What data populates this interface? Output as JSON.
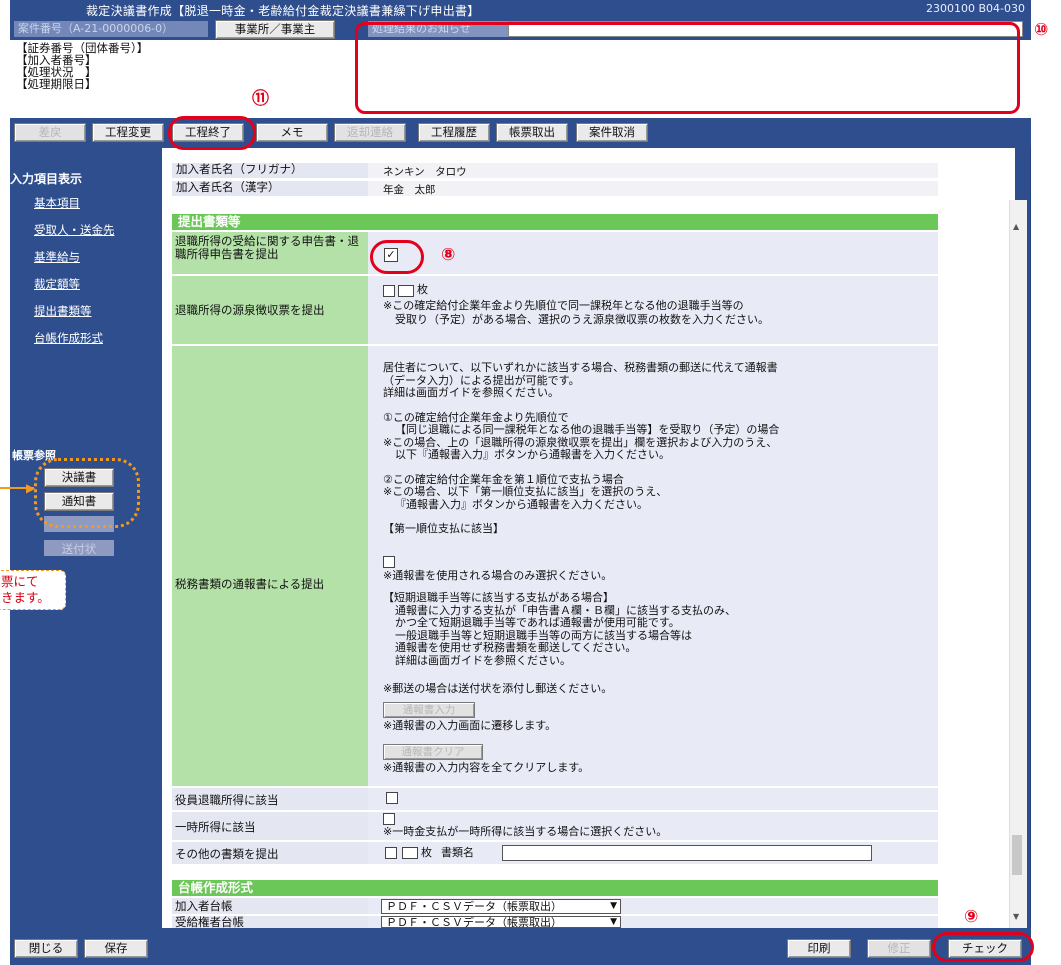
{
  "window": {
    "title": "裁定決議書作成【脱退一時金・老齢給付金裁定決議書兼繰下げ申出書】",
    "screen_code": "2300100 B04-030"
  },
  "case_bar": {
    "case_no": "案件番号（A-21-0000006-0）",
    "office_button": "事業所／事業主",
    "notice_label": "処理結果のお知らせ"
  },
  "info_lines": [
    "【証券番号（団体番号）】",
    "【加入者番号】",
    "【処理状況　】",
    "【処理期限日】"
  ],
  "toolbar": {
    "buttons": [
      "差戻",
      "工程変更",
      "工程終了",
      "メモ",
      "返却連絡",
      "工程履歴",
      "帳票取出",
      "案件取消"
    ]
  },
  "sidebar": {
    "heading": "入力項目表示",
    "items": [
      "基本項目",
      "受取人・送金先",
      "基準給与",
      "裁定額等",
      "提出書類等",
      "台帳作成形式"
    ],
    "report_heading": "帳票参照",
    "report_buttons": [
      "決議書",
      "通知書",
      "",
      "送付状"
    ]
  },
  "member": {
    "kana_label": "加入者氏名（フリガナ）",
    "kana_value": "ネンキン　タロウ",
    "kanji_label": "加入者氏名（漢字）",
    "kanji_value": "年金　太郎"
  },
  "submission": {
    "section_title": "提出書類等",
    "row1_label": "退職所得の受給に関する申告書・退職所得申告書を提出",
    "row1_checked": true,
    "row2_label": "退職所得の源泉徴収票を提出",
    "row2_unit": "枚",
    "row2_note1": "※この確定給付企業年金より先順位で同一課税年となる他の退職手当等の",
    "row2_note2": "受取り（予定）がある場合、選択のうえ源泉徴収票の枚数を入力ください。",
    "row3_label": "税務書類の通報書による提出",
    "row3_lines": [
      "居住者について、以下いずれかに該当する場合、税務書類の郵送に代えて通報書",
      "（データ入力）による提出が可能です。",
      "詳細は画面ガイドを参照ください。",
      "",
      "①この確定給付企業年金より先順位で",
      "【同じ退職による同一課税年となる他の退職手当等】を受取り（予定）の場合",
      "※この場合、上の「退職所得の源泉徴収票を提出」欄を選択および入力のうえ、",
      "以下『通報書入力』ボタンから通報書を入力ください。",
      "",
      "②この確定給付企業年金を第１順位で支払う場合",
      "※この場合、以下「第一順位支払に該当」を選択のうえ、",
      "『通報書入力』ボタンから通報書を入力ください。",
      "",
      "【第一順位支払に該当】"
    ],
    "row3_note_select": "※通報書を使用される場合のみ選択ください。",
    "row3_lines2": [
      "【短期退職手当等に該当する支払がある場合】",
      "通報書に入力する支払が「申告書Ａ欄・Ｂ欄」に該当する支払のみ、",
      "かつ全て短期退職手当等であれば通報書が使用可能です。",
      "一般退職手当等と短期退職手当等の両方に該当する場合等は",
      "通報書を使用せず税務書類を郵送してください。",
      "詳細は画面ガイドを参照ください。"
    ],
    "row3_mail_note": "※郵送の場合は送付状を添付し郵送ください。",
    "input_button": "通報書入力",
    "input_note": "※通報書の入力画面に遷移します。",
    "clear_button": "通報書クリア",
    "clear_note": "※通報書の入力内容を全てクリアします。",
    "row4_label": "役員退職所得に該当",
    "row5_label": "一時所得に該当",
    "row5_note": "※一時金支払が一時所得に該当する場合に選択ください。",
    "row6_label": "その他の書類を提出",
    "row6_unit": "枚",
    "row6_docname": "書類名"
  },
  "ledger": {
    "section_title": "台帳作成形式",
    "member_label": "加入者台帳",
    "member_value": "ＰＤＦ・ＣＳＶデータ（帳票取出）",
    "beneficiary_label": "受給権者台帳",
    "beneficiary_value": "ＰＤＦ・ＣＳＶデータ（帳票取出）"
  },
  "footer": {
    "close": "閉じる",
    "save": "保存",
    "print": "印刷",
    "fix": "修正",
    "check": "チェック"
  },
  "annotations": {
    "n8": "⑧",
    "n9": "⑨",
    "n10": "⑩",
    "n11": "⑪",
    "callout_line1": "票にて",
    "callout_line2": "きます。"
  },
  "colors": {
    "frame": "#2e4e8e",
    "section_green": "#6cc759",
    "label_green": "#b4e1a8",
    "annotation_red": "#e3001b",
    "annotation_orange": "#f39a1d"
  }
}
